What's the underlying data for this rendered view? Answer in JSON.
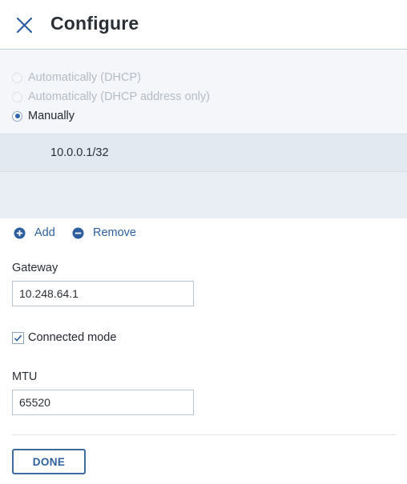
{
  "header": {
    "title": "Configure",
    "close_icon": "close-icon"
  },
  "address_mode": {
    "options": [
      {
        "label": "Automatically (DHCP)",
        "state": "disabled"
      },
      {
        "label": "Automatically (DHCP address only)",
        "state": "disabled"
      },
      {
        "label": "Manually",
        "state": "selected"
      }
    ]
  },
  "addresses": {
    "items": [
      "10.0.0.1/32"
    ]
  },
  "actions": {
    "add_label": "Add",
    "add_icon": "plus-circle-icon",
    "remove_label": "Remove",
    "remove_icon": "minus-circle-icon"
  },
  "gateway": {
    "label": "Gateway",
    "value": "10.248.64.1"
  },
  "connected_mode": {
    "label": "Connected mode",
    "checked": true
  },
  "mtu": {
    "label": "MTU",
    "value": "65520"
  },
  "footer": {
    "done_label": "DONE"
  },
  "colors": {
    "accent": "#2d5f9e",
    "header_border": "#b9c9dc",
    "panel_bg": "#f4f6f9",
    "list_row_bg": "#e3e9f1"
  }
}
